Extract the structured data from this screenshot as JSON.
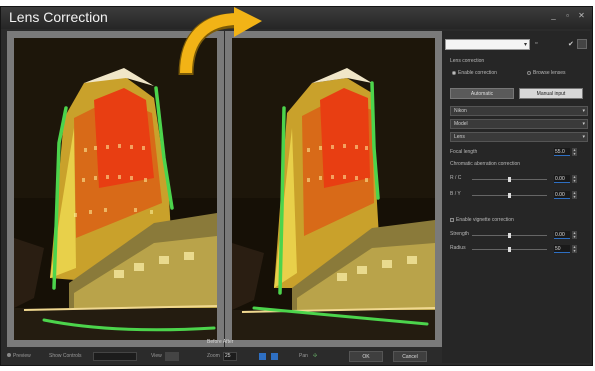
{
  "window": {
    "title": "Lens Correction"
  },
  "title_controls": [
    "_",
    "▫",
    "✕"
  ],
  "before_after_label": "Before  After",
  "bottom": {
    "preview_label": "Preview",
    "show_controls_label": "Show Controls",
    "view_label": "View",
    "zoom_label": "Zoom",
    "zoom_value": "25",
    "pan_label": "Pan",
    "ok_label": "OK",
    "cancel_label": "Cancel"
  },
  "panel": {
    "preset_value": "",
    "section_lens": "Lens correction",
    "radio_enable": "Enable correction",
    "radio_browse": "Browse lenses",
    "btn_automatic": "Automatic",
    "btn_manual": "Manual input",
    "dropdowns": [
      "Nikon",
      "Model",
      "Lens"
    ],
    "focal_length_label": "Focal length",
    "focal_length_value": "55.0",
    "chromatic_heading": "Chromatic aberration correction",
    "rc_label": "R / C",
    "rc_value": "0.00",
    "by_label": "B / Y",
    "by_value": "0.00",
    "vignette_label": "Enable vignette correction",
    "strength_label": "Strength",
    "strength_value": "0.00",
    "radius_label": "Radius",
    "radius_value": "50"
  },
  "colors": {
    "window_bg": "#2b2b2b",
    "accent": "#2e6fc2",
    "arrow": "#f2b316",
    "guide": "#4cd44c"
  }
}
